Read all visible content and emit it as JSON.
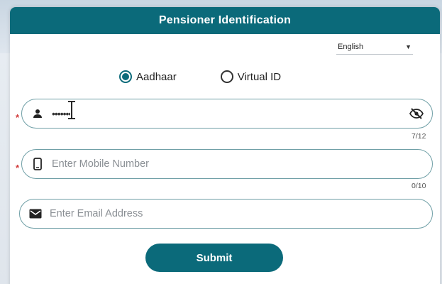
{
  "header": {
    "title": "Pensioner Identification"
  },
  "language": {
    "selected": "English"
  },
  "id_type": {
    "options": [
      {
        "label": "Aadhaar",
        "selected": true
      },
      {
        "label": "Virtual ID",
        "selected": false
      }
    ]
  },
  "fields": {
    "aadhaar": {
      "value": "•••••••",
      "counter": "7/12",
      "required": "*"
    },
    "mobile": {
      "placeholder": "Enter Mobile Number",
      "counter": "0/10",
      "required": "*"
    },
    "email": {
      "placeholder": "Enter Email Address"
    }
  },
  "submit": {
    "label": "Submit"
  },
  "colors": {
    "primary": "#0b6a7a",
    "border": "#6f9fa6",
    "required": "#d23d3d"
  }
}
